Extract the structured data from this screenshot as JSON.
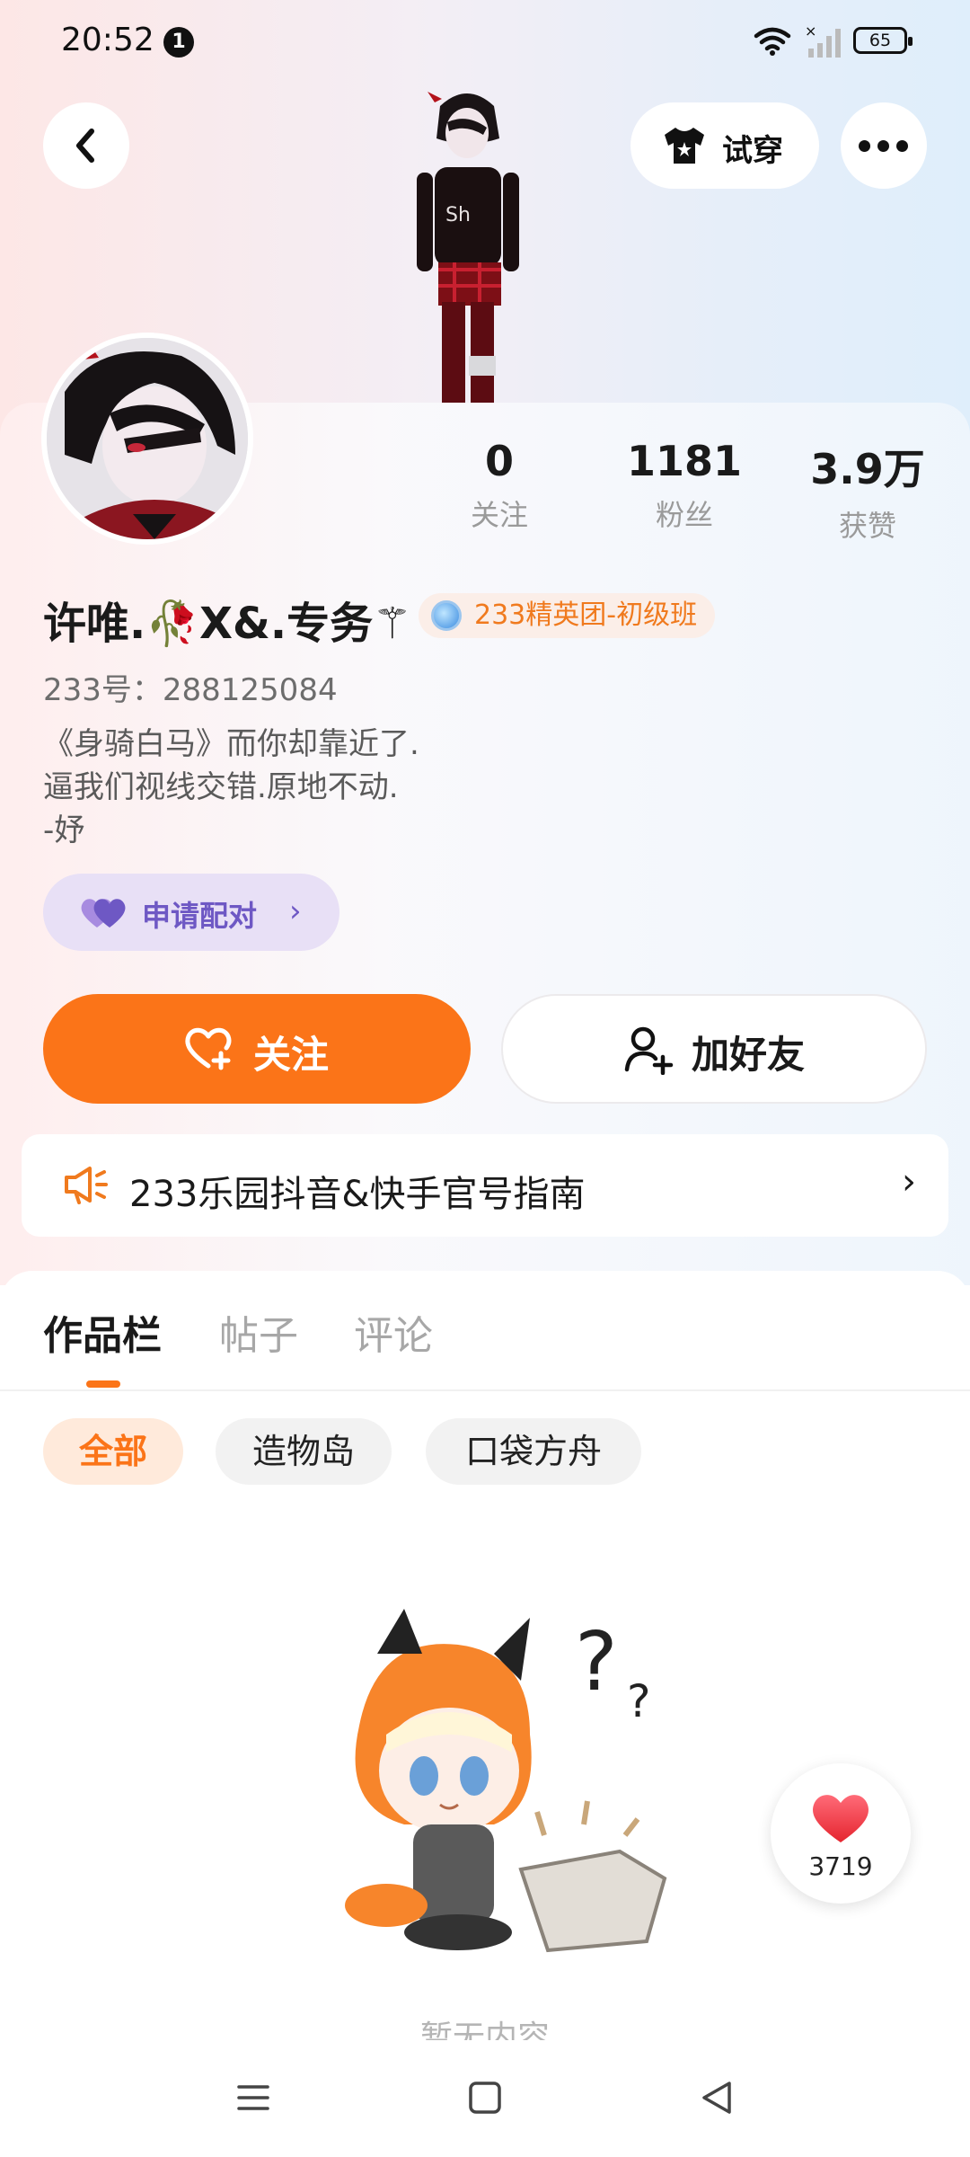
{
  "status_bar": {
    "time": "20:52",
    "notification_count": "1",
    "battery": "65"
  },
  "header": {
    "try_on_label": "试穿"
  },
  "stats": [
    {
      "value": "0",
      "label": "关注"
    },
    {
      "value": "1181",
      "label": "粉丝"
    },
    {
      "value": "3.9万",
      "label": "获赞"
    }
  ],
  "profile": {
    "nickname": "许唯.🥀X&.专务⚚",
    "badge": "233精英团-初级班",
    "uid": "233号：288125084",
    "bio": "《身骑白马》而你却靠近了.\n逼我们视线交错.原地不动.\n-妤",
    "pair_label": "申请配对"
  },
  "actions": {
    "follow_label": "关注",
    "add_friend_label": "加好友"
  },
  "guide": {
    "label": "233乐园抖音&快手官号指南"
  },
  "tabs": [
    "作品栏",
    "帖子",
    "评论"
  ],
  "chips": [
    "全部",
    "造物岛",
    "口袋方舟"
  ],
  "empty": {
    "text": "暂无内容"
  },
  "like_fab": {
    "count": "3719"
  },
  "colors": {
    "accent": "#fb7418",
    "pair": "#6e58c4",
    "badge_text": "#f07a1e"
  },
  "icons": {
    "back": "chevron-left-icon",
    "try_on": "shirt-icon",
    "more": "more-dots-icon",
    "pair": "double-heart-icon",
    "follow": "heart-plus-icon",
    "add_friend": "user-plus-icon",
    "guide": "megaphone-icon",
    "like": "heart-icon"
  }
}
